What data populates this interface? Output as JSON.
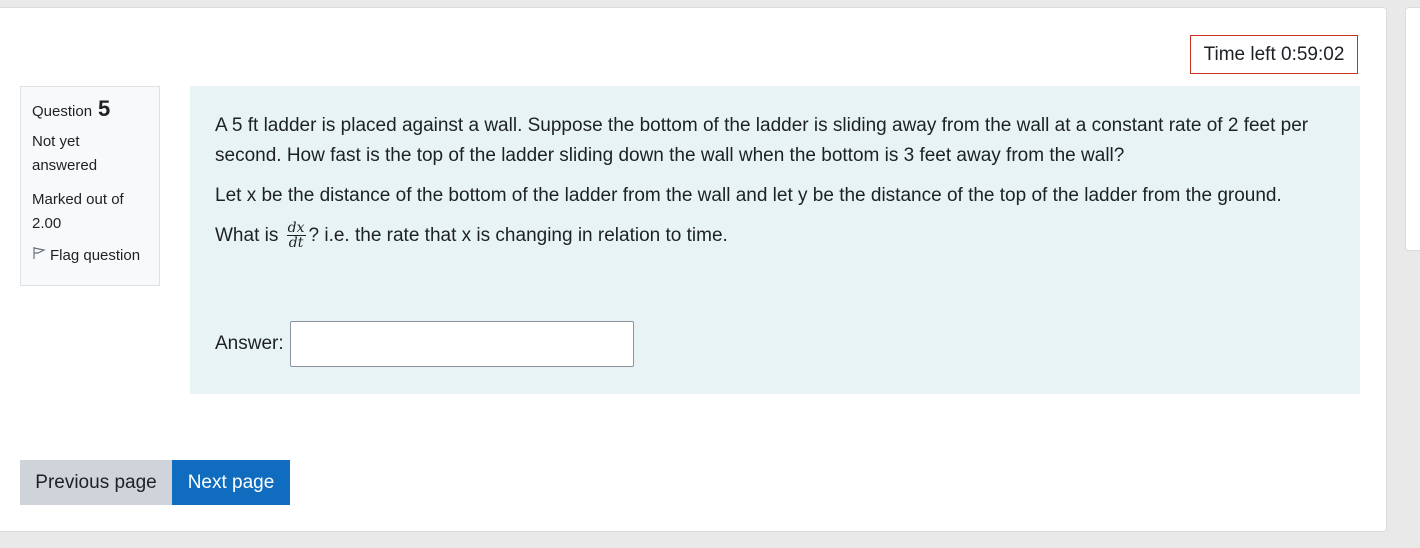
{
  "timer": {
    "label": "Time left 0:59:02"
  },
  "question_info": {
    "question_label": "Question",
    "question_number": "5",
    "state": "Not yet answered",
    "grade": "Marked out of 2.00",
    "flag_label": "Flag question"
  },
  "question": {
    "paragraph1": "A 5 ft ladder is placed against a wall. Suppose the bottom of the ladder is sliding away from the wall at a constant rate of 2 feet per second. How fast is the top of the ladder sliding down the wall when the bottom is 3 feet away from the wall?",
    "paragraph2": "Let x be the distance of the bottom of the ladder from the wall and let y be the distance of the top of the ladder from the ground.",
    "prompt_prefix": "What is",
    "fraction_numerator": "dx",
    "fraction_denominator": "dt",
    "prompt_suffix": "? i.e. the rate that x is changing in relation to time."
  },
  "answer": {
    "label": "Answer:",
    "value": ""
  },
  "navigation": {
    "previous_label": "Previous page",
    "next_label": "Next page"
  },
  "colors": {
    "accent": "#0f6cbf",
    "timer_border": "#ca3120",
    "question_bg": "#e7f3f5"
  }
}
